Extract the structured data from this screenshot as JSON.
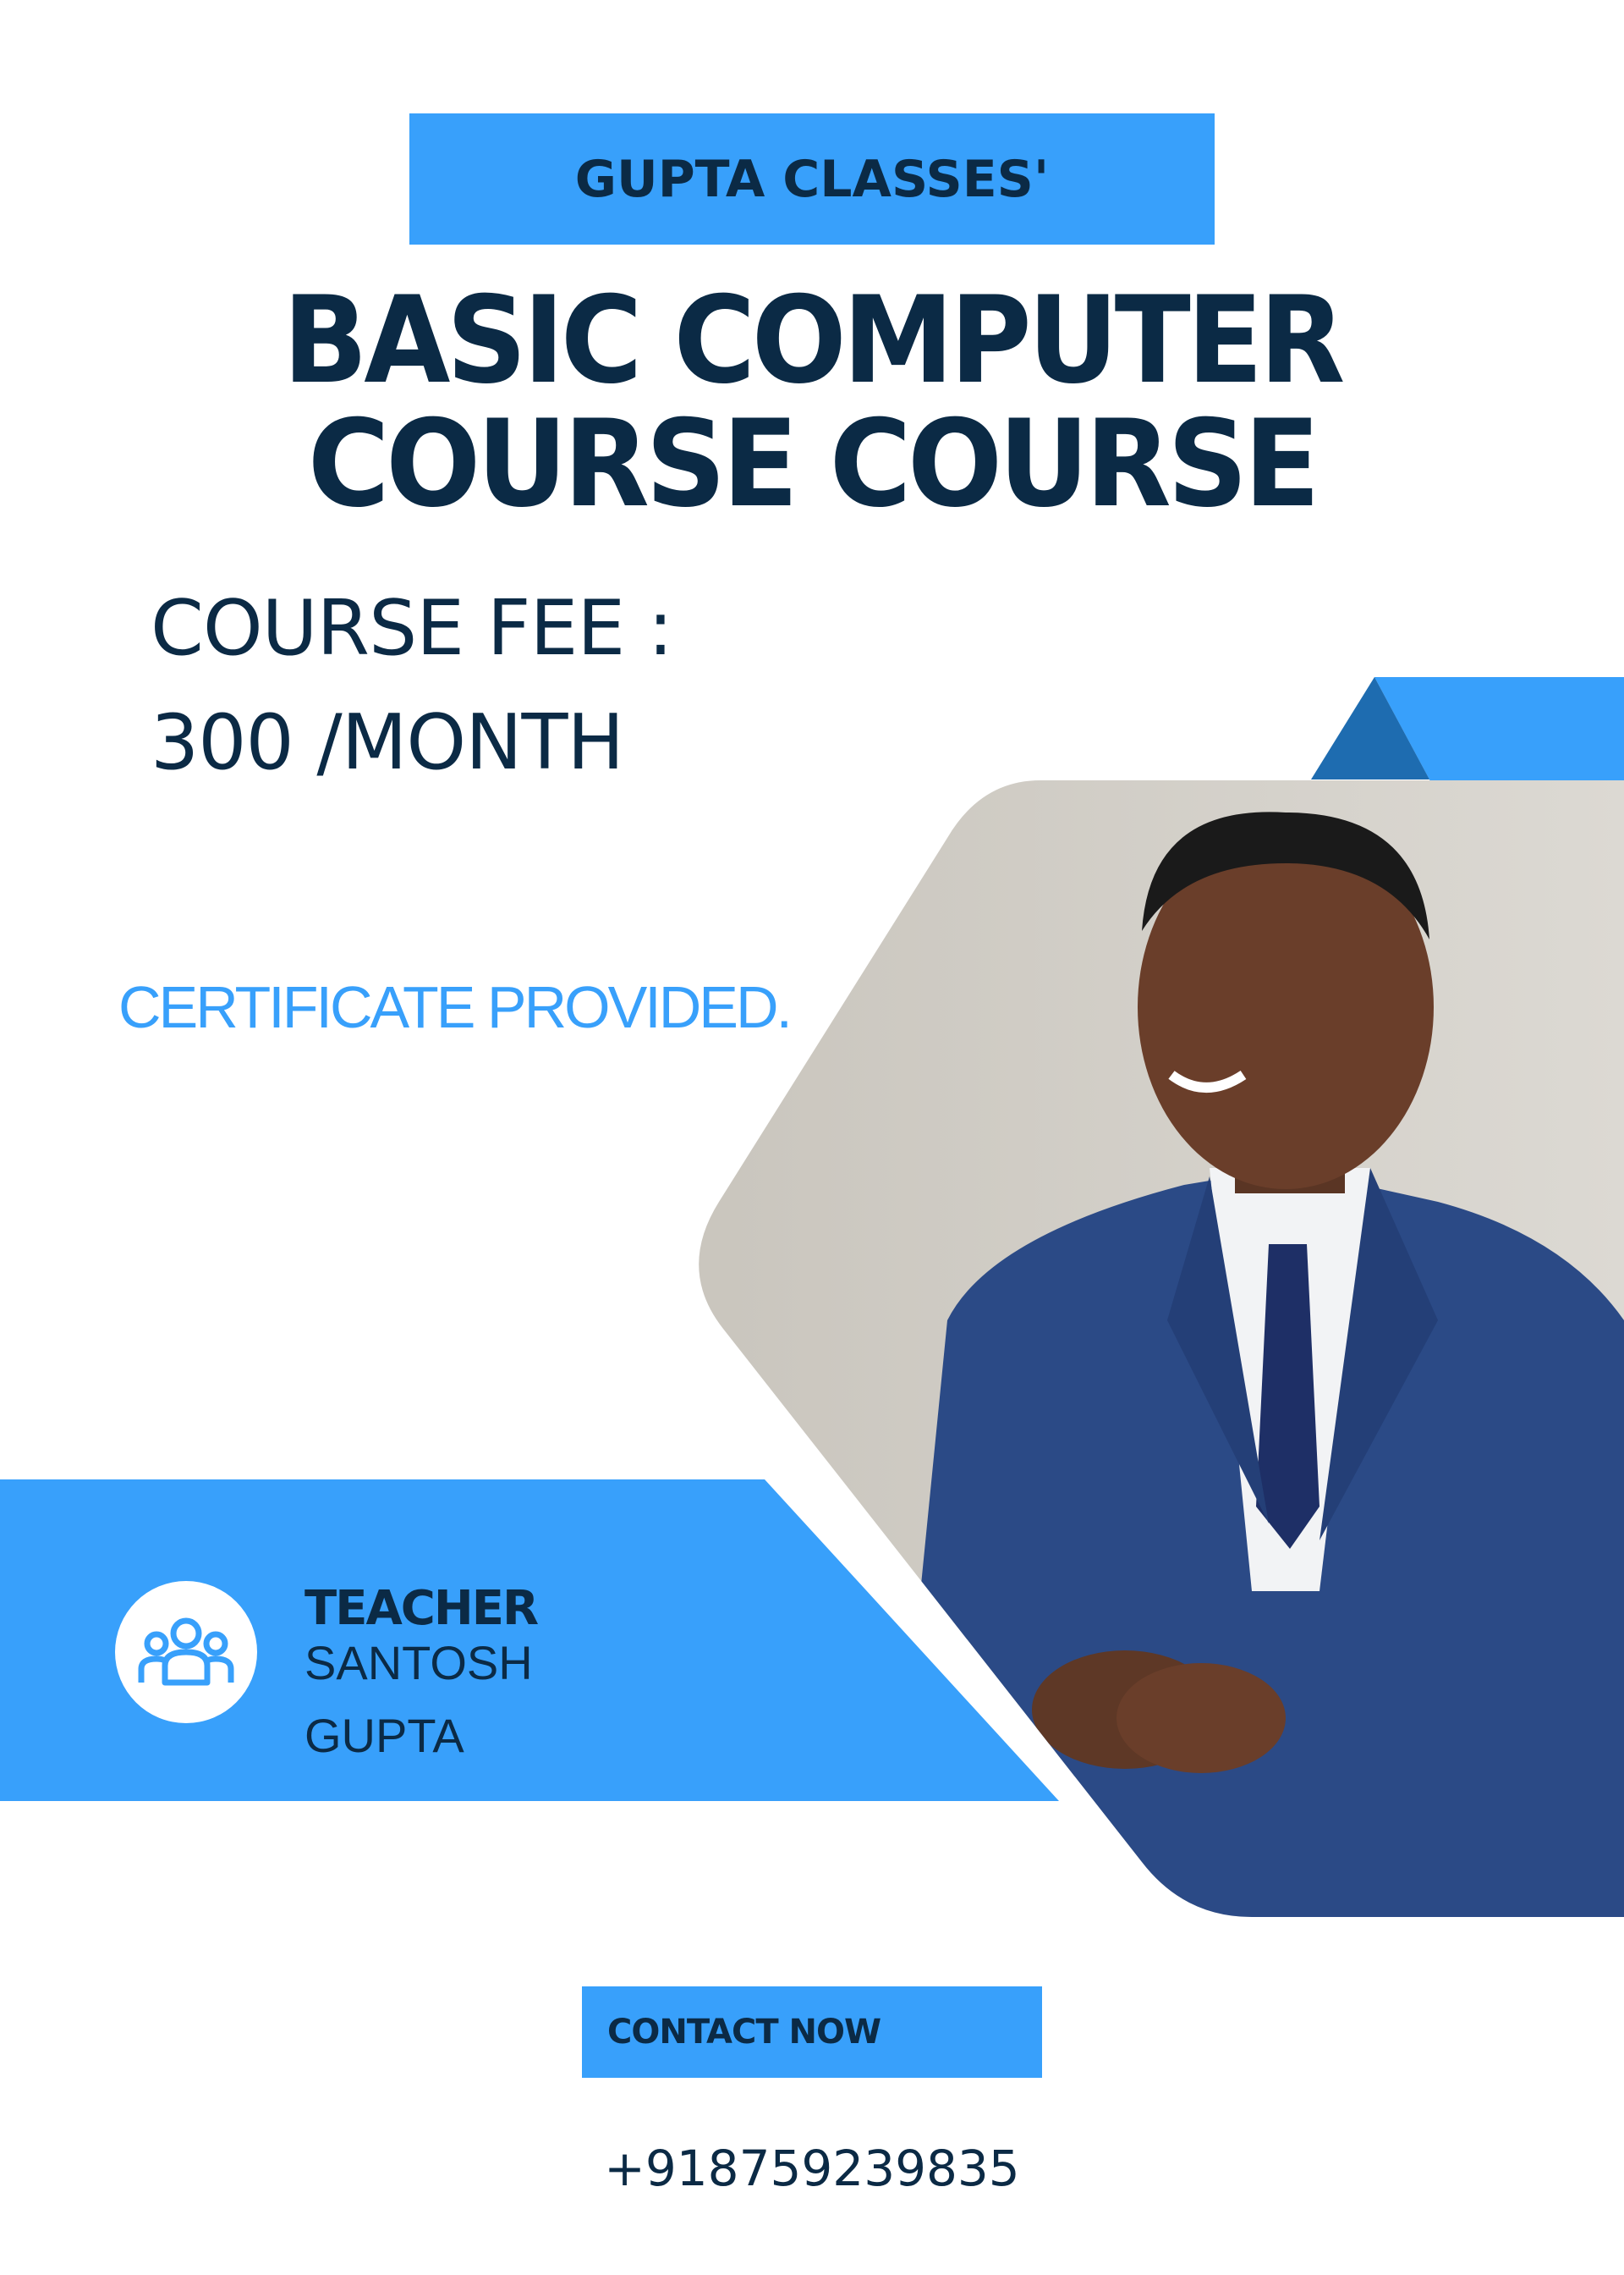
{
  "header": {
    "brand": "GUPTA CLASSES'"
  },
  "title": {
    "line1": "BASIC COMPUTER",
    "line2": "COURSE COURSE"
  },
  "fee": {
    "label": "COURSE FEE :",
    "value": "300 /MONTH"
  },
  "certificate": "CERTIFICATE PROVIDED.",
  "teacher": {
    "title": "TEACHER",
    "name_line1": "SANTOSH",
    "name_line2": "GUPTA",
    "icon": "users-group-icon"
  },
  "contact": {
    "button_label": "CONTACT NOW",
    "phone": "+918759239835"
  },
  "photo": {
    "subject": "man-in-blue-suit-photo"
  },
  "colors": {
    "accent": "#38a0fb",
    "accent_dark": "#1e6cb0",
    "text_dark": "#0b2a45",
    "background": "#ffffff"
  }
}
